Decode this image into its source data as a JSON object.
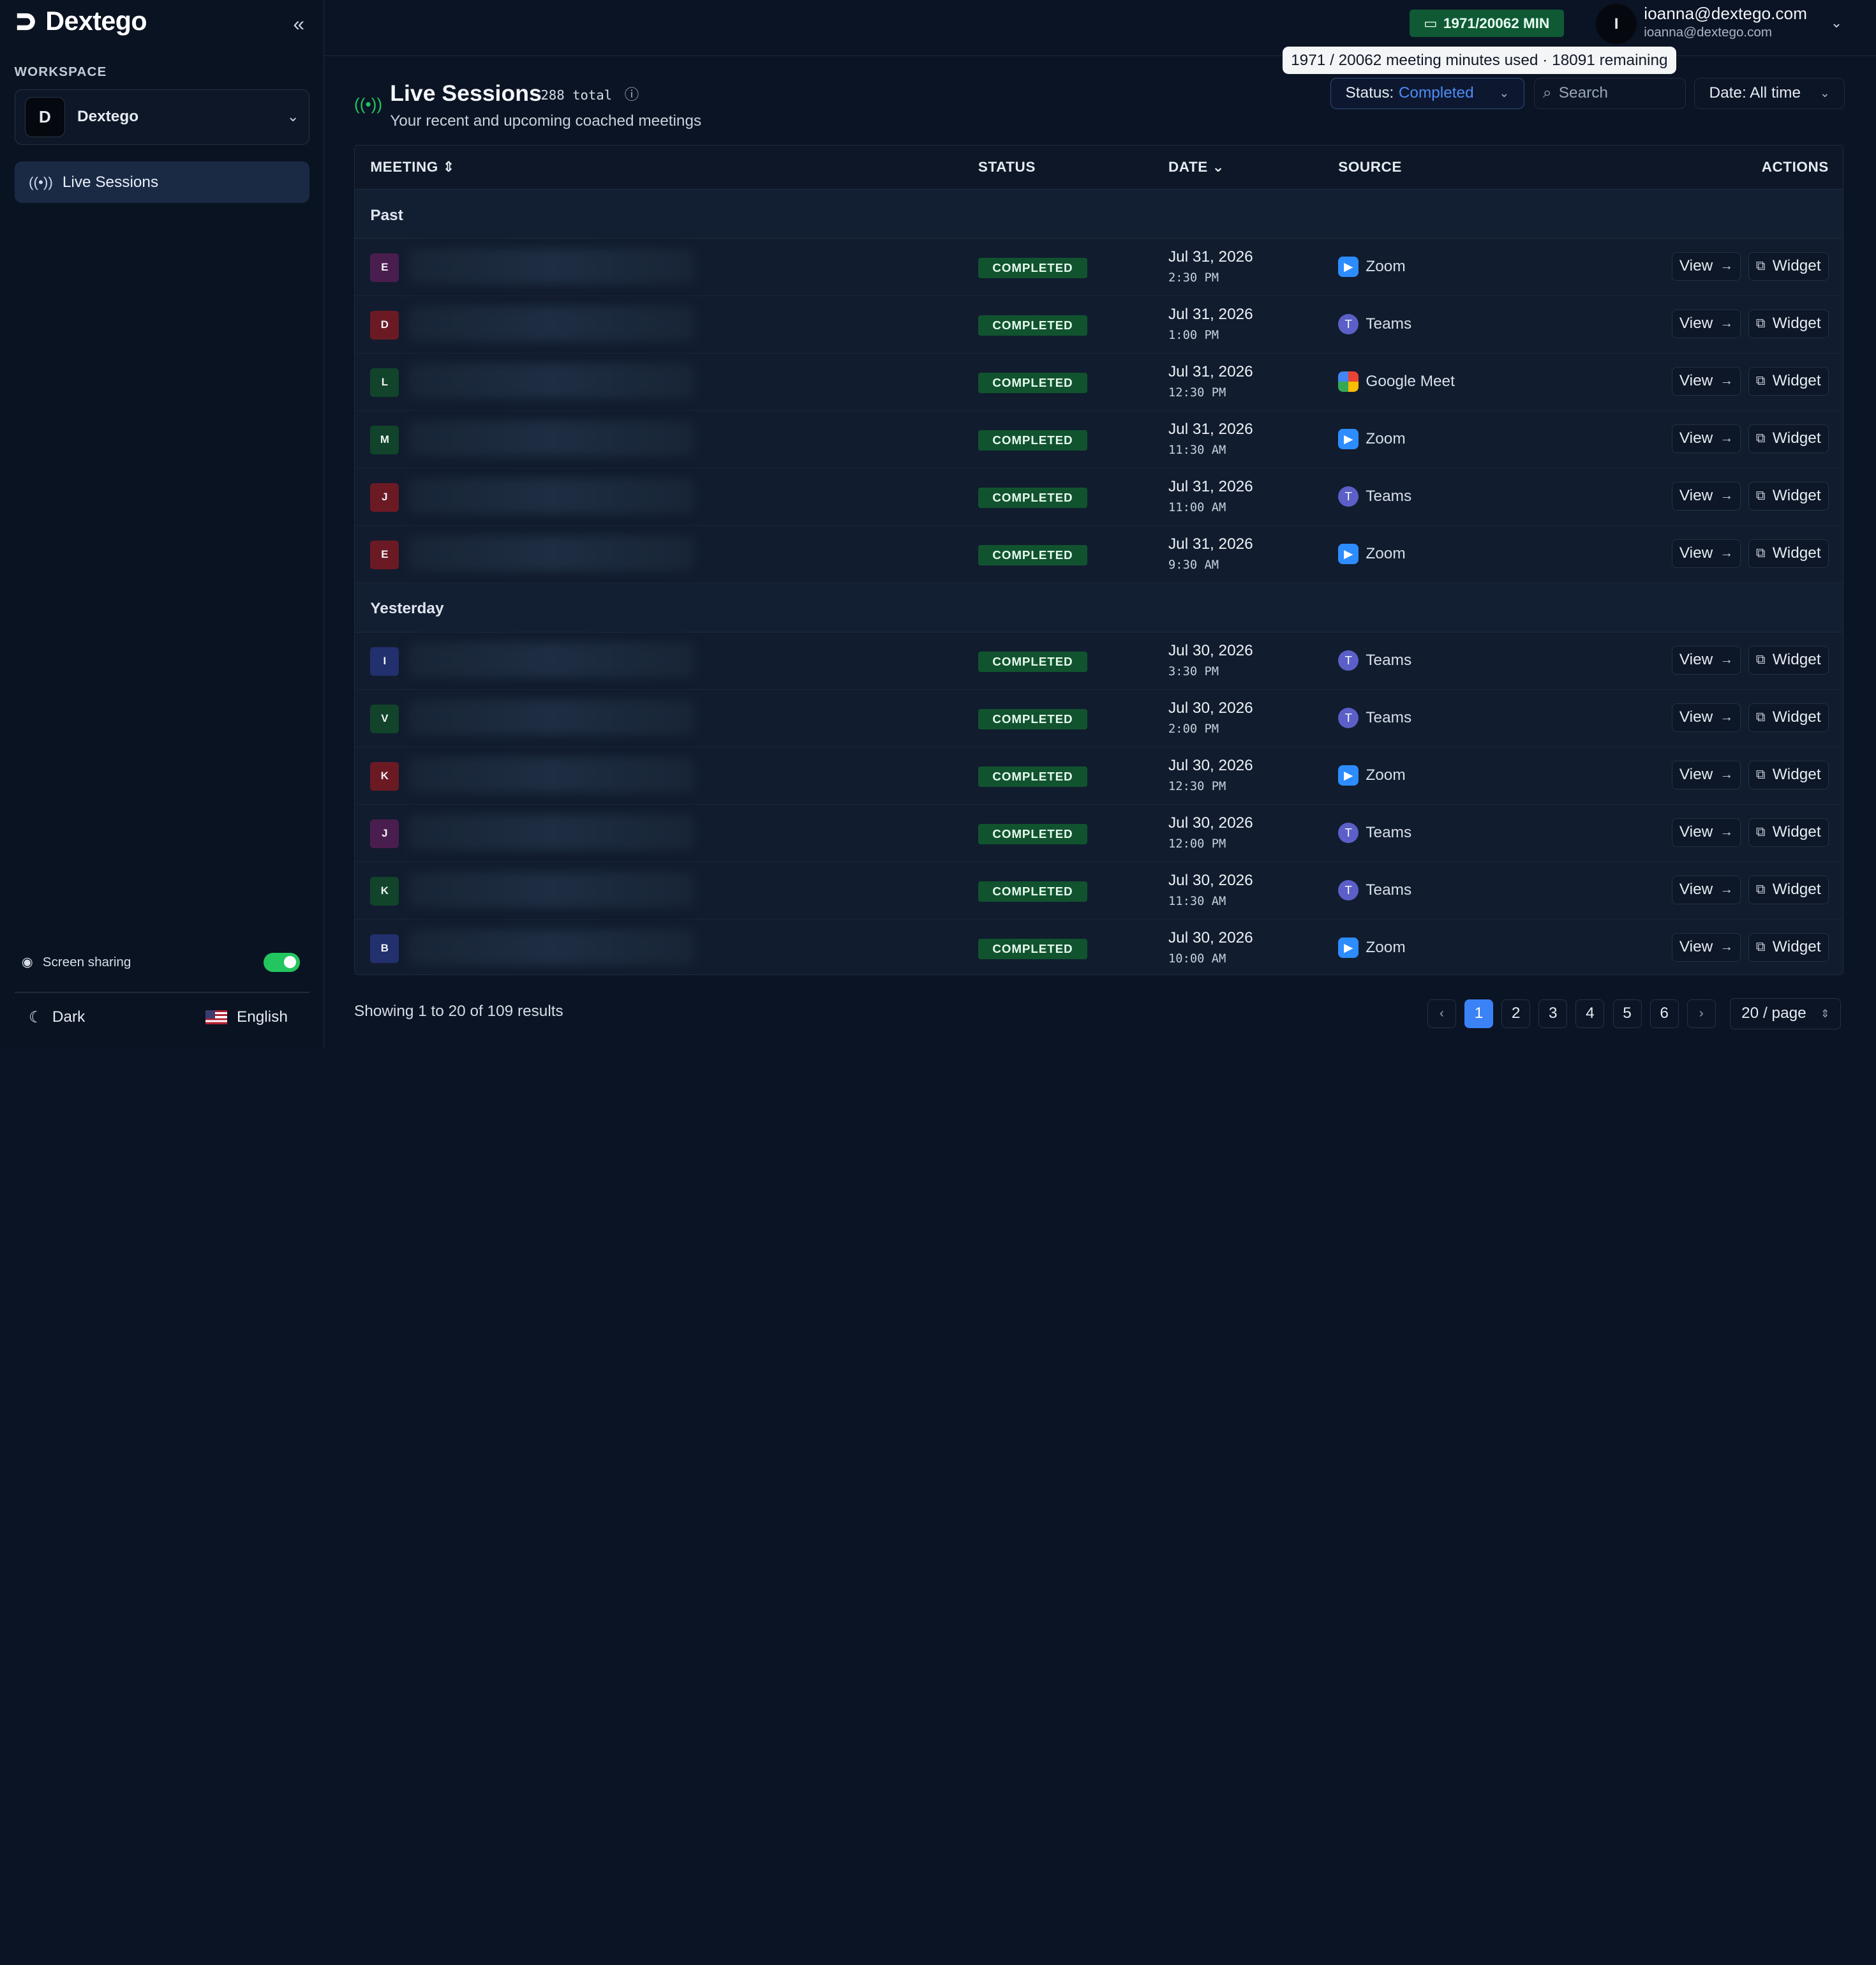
{
  "brand": {
    "name": "Dextego"
  },
  "sidebar": {
    "workspace_label": "WORKSPACE",
    "workspace": {
      "initial": "D",
      "name": "Dextego"
    },
    "nav": [
      {
        "label": "Live Sessions",
        "icon": "broadcast-icon"
      }
    ],
    "screen_sharing_label": "Screen sharing",
    "screen_sharing_on": true,
    "theme_label": "Dark",
    "language_label": "English"
  },
  "topbar": {
    "minutes_badge": "1971/20062 MIN",
    "tooltip": "1971 / 20062 meeting minutes used · 18091 remaining",
    "user": {
      "initial": "I",
      "name": "ioanna@dextego.com",
      "email": "ioanna@dextego.com"
    }
  },
  "page": {
    "title": "Live Sessions",
    "total": "288 total",
    "subtitle": "Your recent and upcoming coached meetings"
  },
  "filters": {
    "status_label": "Status:",
    "status_value": "Completed",
    "search_placeholder": "Search",
    "date_label": "Date: All time"
  },
  "table": {
    "headers": {
      "meeting": "MEETING",
      "status": "STATUS",
      "date": "DATE",
      "source": "SOURCE",
      "actions": "ACTIONS"
    },
    "view_label": "View",
    "widget_label": "Widget",
    "groups": [
      {
        "label": "Past",
        "rows": [
          {
            "initial": "E",
            "color": "#4a1d4f",
            "status": "COMPLETED",
            "date": "Jul 31, 2026",
            "time": "2:30 PM",
            "source": "Zoom"
          },
          {
            "initial": "D",
            "color": "#6b1a24",
            "status": "COMPLETED",
            "date": "Jul 31, 2026",
            "time": "1:00 PM",
            "source": "Teams"
          },
          {
            "initial": "L",
            "color": "#11442b",
            "status": "COMPLETED",
            "date": "Jul 31, 2026",
            "time": "12:30 PM",
            "source": "Google Meet"
          },
          {
            "initial": "M",
            "color": "#11442b",
            "status": "COMPLETED",
            "date": "Jul 31, 2026",
            "time": "11:30 AM",
            "source": "Zoom"
          },
          {
            "initial": "J",
            "color": "#6b1a24",
            "status": "COMPLETED",
            "date": "Jul 31, 2026",
            "time": "11:00 AM",
            "source": "Teams"
          },
          {
            "initial": "E",
            "color": "#6b1a24",
            "status": "COMPLETED",
            "date": "Jul 31, 2026",
            "time": "9:30 AM",
            "source": "Zoom"
          }
        ]
      },
      {
        "label": "Yesterday",
        "rows": [
          {
            "initial": "I",
            "color": "#23306e",
            "status": "COMPLETED",
            "date": "Jul 30, 2026",
            "time": "3:30 PM",
            "source": "Teams"
          },
          {
            "initial": "V",
            "color": "#11442b",
            "status": "COMPLETED",
            "date": "Jul 30, 2026",
            "time": "2:00 PM",
            "source": "Teams"
          },
          {
            "initial": "K",
            "color": "#6b1a24",
            "status": "COMPLETED",
            "date": "Jul 30, 2026",
            "time": "12:30 PM",
            "source": "Zoom"
          },
          {
            "initial": "J",
            "color": "#4a1d4f",
            "status": "COMPLETED",
            "date": "Jul 30, 2026",
            "time": "12:00 PM",
            "source": "Teams"
          },
          {
            "initial": "K",
            "color": "#11442b",
            "status": "COMPLETED",
            "date": "Jul 30, 2026",
            "time": "11:30 AM",
            "source": "Teams"
          },
          {
            "initial": "B",
            "color": "#23306e",
            "status": "COMPLETED",
            "date": "Jul 30, 2026",
            "time": "10:00 AM",
            "source": "Zoom"
          }
        ]
      }
    ]
  },
  "footer": {
    "showing": "Showing 1 to 20 of 109 results",
    "pages": [
      "1",
      "2",
      "3",
      "4",
      "5",
      "6"
    ],
    "active_page": "1",
    "per_page": "20 / page"
  }
}
